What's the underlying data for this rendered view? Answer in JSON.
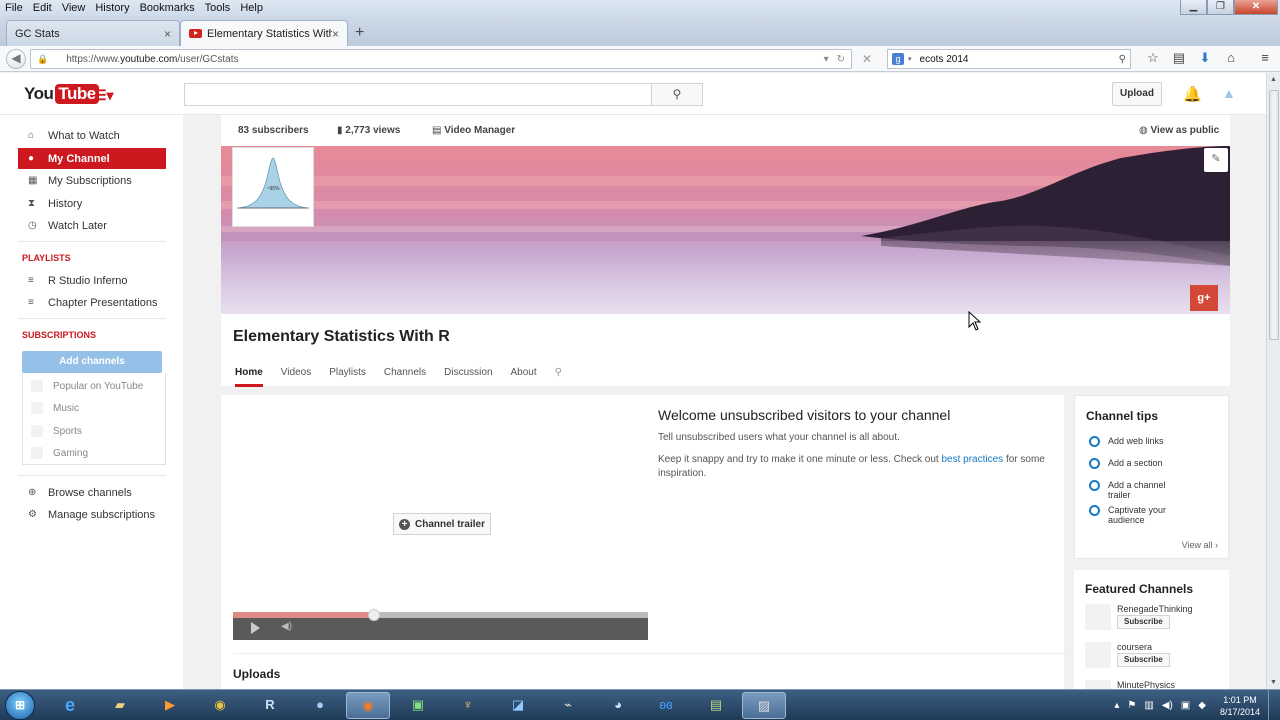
{
  "browser": {
    "menu": [
      "File",
      "Edit",
      "View",
      "History",
      "Bookmarks",
      "Tools",
      "Help"
    ],
    "tabs": [
      {
        "label": "GC Stats"
      },
      {
        "label": "Elementary Statistics With ..."
      }
    ],
    "url": {
      "prefix": "https://www.",
      "host": "youtube.com",
      "path": "/user/GCstats"
    },
    "search_engine_icon": "google-icon",
    "search_value": "ecots 2014"
  },
  "youtube": {
    "logo": {
      "you": "You",
      "tube": "Tube"
    },
    "upload_label": "Upload",
    "guide": {
      "main": [
        {
          "label": "What to Watch",
          "icon": "home-icon"
        },
        {
          "label": "My Channel",
          "icon": "user-icon",
          "active": true
        },
        {
          "label": "My Subscriptions",
          "icon": "subscriptions-icon"
        },
        {
          "label": "History",
          "icon": "hourglass-icon"
        },
        {
          "label": "Watch Later",
          "icon": "clock-icon"
        }
      ],
      "playlists_heading": "PLAYLISTS",
      "playlists": [
        {
          "label": "R Studio Inferno"
        },
        {
          "label": "Chapter Presentations"
        }
      ],
      "subscriptions_heading": "SUBSCRIPTIONS",
      "add_channels_label": "Add channels",
      "subscriptions": [
        {
          "label": "Popular on YouTube"
        },
        {
          "label": "Music"
        },
        {
          "label": "Sports"
        },
        {
          "label": "Gaming"
        }
      ],
      "footer": [
        {
          "label": "Browse channels",
          "icon": "plus-circle-icon"
        },
        {
          "label": "Manage subscriptions",
          "icon": "gear-icon"
        }
      ]
    },
    "channel": {
      "subscribers": "83 subscribers",
      "views": "2,773 views",
      "video_manager": "Video Manager",
      "view_as_public": "View as public",
      "avatar_text": "~95%",
      "title": "Elementary Statistics With R",
      "tabs": [
        "Home",
        "Videos",
        "Playlists",
        "Channels",
        "Discussion",
        "About"
      ],
      "active_tab": "Home",
      "trailer_button": "Channel trailer",
      "player_progress": 0.34,
      "welcome_title": "Welcome unsubscribed visitors to your channel",
      "welcome_line1": "Tell unsubscribed users what your channel is all about.",
      "welcome_line2_start": "Keep it snappy and try to make it one minute or less. Check out ",
      "welcome_link": "best practices",
      "welcome_line2_end": " for some inspiration.",
      "uploads_heading": "Uploads"
    },
    "tips": {
      "title": "Channel tips",
      "items": [
        "Add web links",
        "Add a section",
        "Add a channel trailer",
        "Captivate your audience"
      ],
      "view_all": "View all"
    },
    "featured": {
      "title": "Featured Channels",
      "items": [
        {
          "name": "RenegadeThinking",
          "button": "Subscribe"
        },
        {
          "name": "coursera",
          "button": "Subscribe"
        },
        {
          "name": "MinutePhysics"
        }
      ]
    }
  },
  "taskbar": {
    "clock_time": "1:01 PM",
    "clock_date": "8/17/2014"
  },
  "colors": {
    "youtube_red": "#cc181e",
    "link_blue": "#167ac6"
  }
}
